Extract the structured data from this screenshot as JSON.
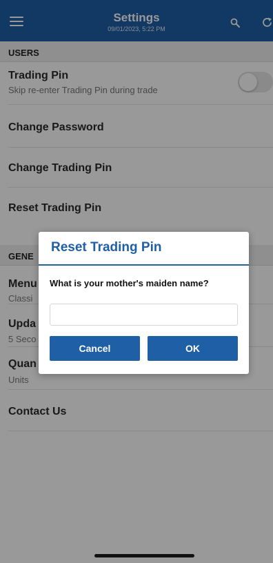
{
  "header": {
    "title": "Settings",
    "timestamp": "09/01/2023, 5:22 PM",
    "left_icon": "hamburger-menu-icon",
    "right_icons": [
      "search-icon",
      "refresh-icon"
    ]
  },
  "sections": {
    "users": {
      "label": "USERS",
      "items": [
        {
          "title": "Trading Pin",
          "subtitle": "Skip re-enter Trading Pin during trade",
          "toggle_on": false
        },
        {
          "title": "Change Password"
        },
        {
          "title": "Change Trading Pin"
        },
        {
          "title": "Reset Trading Pin"
        }
      ]
    },
    "general": {
      "label": "GENE",
      "items": [
        {
          "title": "Menu",
          "subtitle": "Classi"
        },
        {
          "title": "Upda",
          "subtitle": "5 Seco"
        },
        {
          "title": "Quan",
          "subtitle": "Units"
        },
        {
          "title": "Contact Us"
        }
      ]
    }
  },
  "dialog": {
    "title": "Reset Trading Pin",
    "question": "What is your mother's maiden name?",
    "input_value": "",
    "cancel_label": "Cancel",
    "ok_label": "OK"
  },
  "colors": {
    "primary": "#1f5fa6",
    "section_bg": "#eeeeee",
    "overlay": "rgba(0,0,0,0.4)"
  }
}
